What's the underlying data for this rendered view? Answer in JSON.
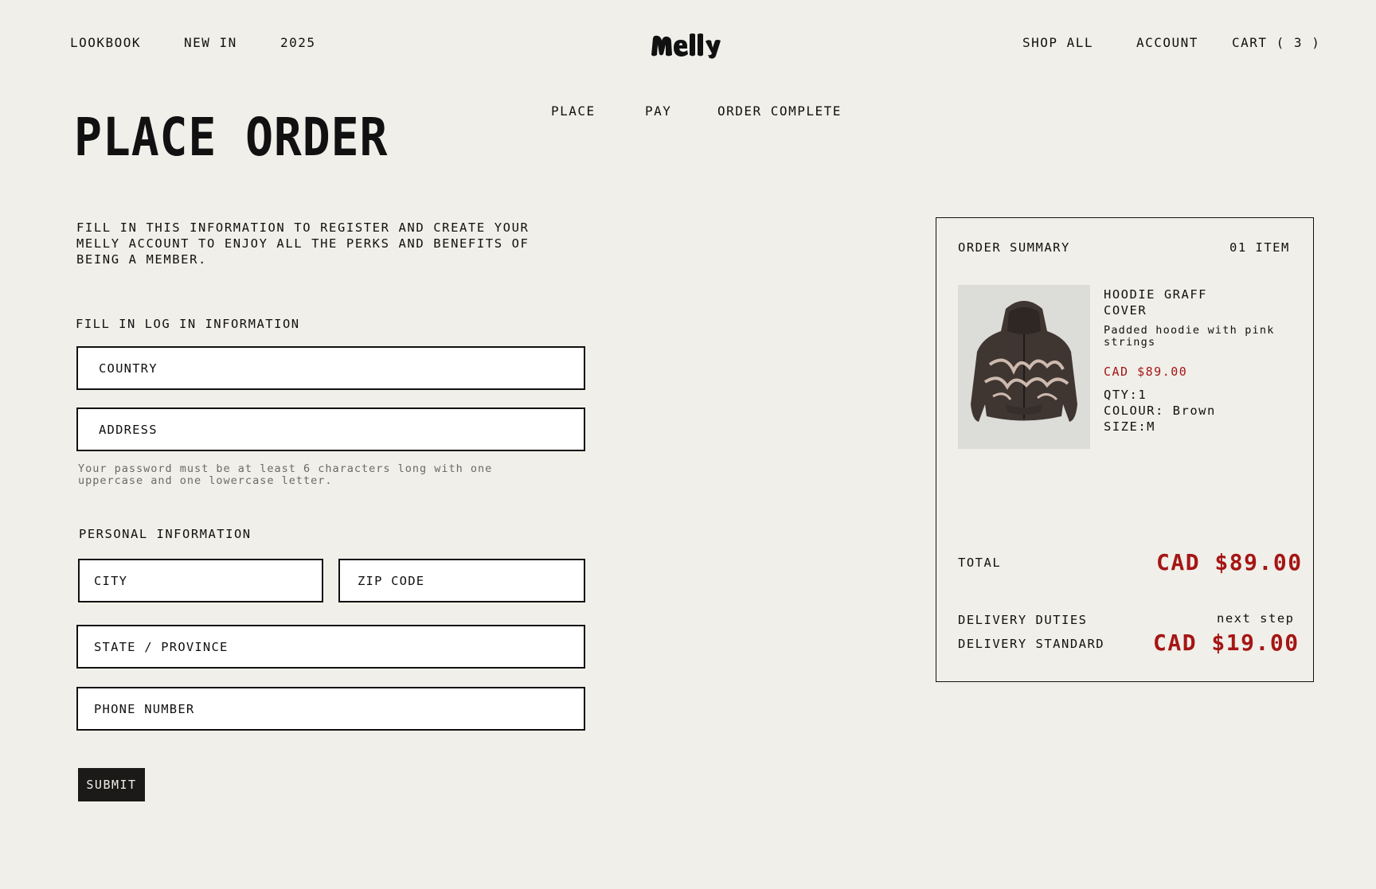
{
  "header": {
    "nav_left": [
      "LOOKBOOK",
      "NEW IN",
      "2025"
    ],
    "brand": "melly",
    "nav_right": {
      "shop_all": "SHOP ALL",
      "account": "ACCOUNT",
      "cart": "CART ( 3 )"
    }
  },
  "steps": [
    "PLACE",
    "PAY",
    "ORDER COMPLETE"
  ],
  "page_title": "PLACE ORDER",
  "intro": "FILL IN THIS INFORMATION TO REGISTER AND CREATE YOUR MELLY ACCOUNT TO ENJOY ALL THE PERKS AND BENEFITS OF BEING A MEMBER.",
  "login_section": {
    "label": "FILL IN LOG IN INFORMATION",
    "country": "COUNTRY",
    "address": "ADDRESS",
    "hint": "Your password must be at least 6 characters long with one uppercase and one lowercase letter."
  },
  "personal_section": {
    "label": "PERSONAL INFORMATION",
    "city": "CITY",
    "zip": "ZIP CODE",
    "state": "STATE / PROVINCE",
    "phone": "PHONE NUMBER"
  },
  "submit_label": "SUBMIT",
  "summary": {
    "title": "ORDER SUMMARY",
    "count": "01 ITEM",
    "product": {
      "name_line1": "HOODIE GRAFF",
      "name_line2": "COVER",
      "description": "Padded hoodie with pink strings",
      "price": "CAD $89.00",
      "qty": "QTY:1",
      "colour": "COLOUR: Brown",
      "size": "SIZE:M"
    },
    "total_label": "TOTAL",
    "total_value": "CAD $89.00",
    "delivery_duties_label": "DELIVERY DUTIES",
    "delivery_duties_value": "next step",
    "delivery_standard_label": "DELIVERY STANDARD",
    "delivery_standard_value": "CAD $19.00"
  },
  "colors": {
    "background": "#f0efe9",
    "price_red": "#a51515",
    "button_dark": "#1c1a18"
  }
}
